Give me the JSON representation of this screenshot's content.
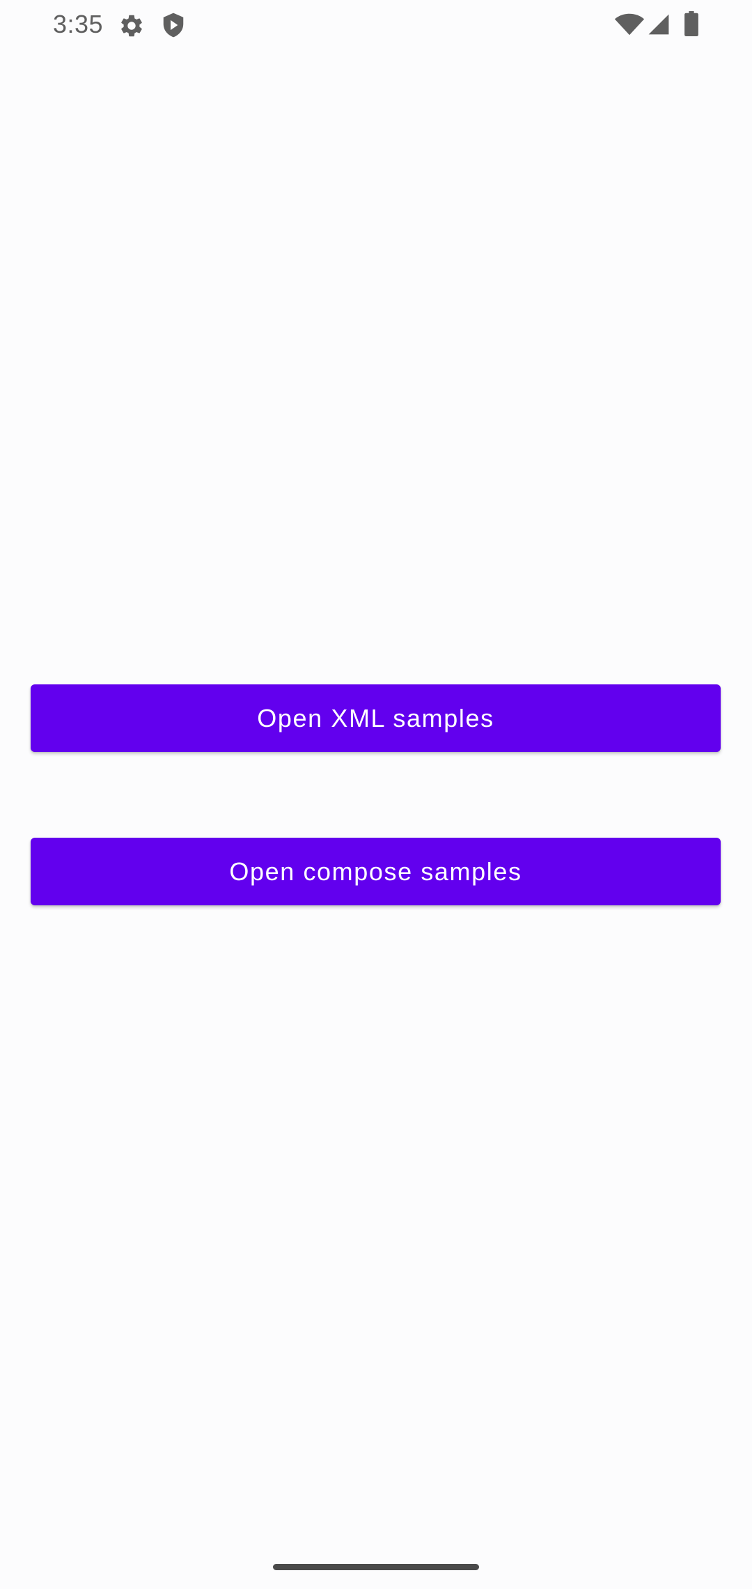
{
  "status_bar": {
    "time": "3:35",
    "left_icons": [
      "settings-icon",
      "shield-play-icon"
    ],
    "right_icons": [
      "wifi-icon",
      "cellular-signal-icon",
      "battery-icon"
    ]
  },
  "main": {
    "buttons": [
      {
        "label": "Open XML samples"
      },
      {
        "label": "Open compose samples"
      }
    ]
  },
  "colors": {
    "primary": "#6200ee",
    "background": "#fcfcfd",
    "button_text": "#ffffff",
    "status_icons": "#5f5f5f"
  }
}
